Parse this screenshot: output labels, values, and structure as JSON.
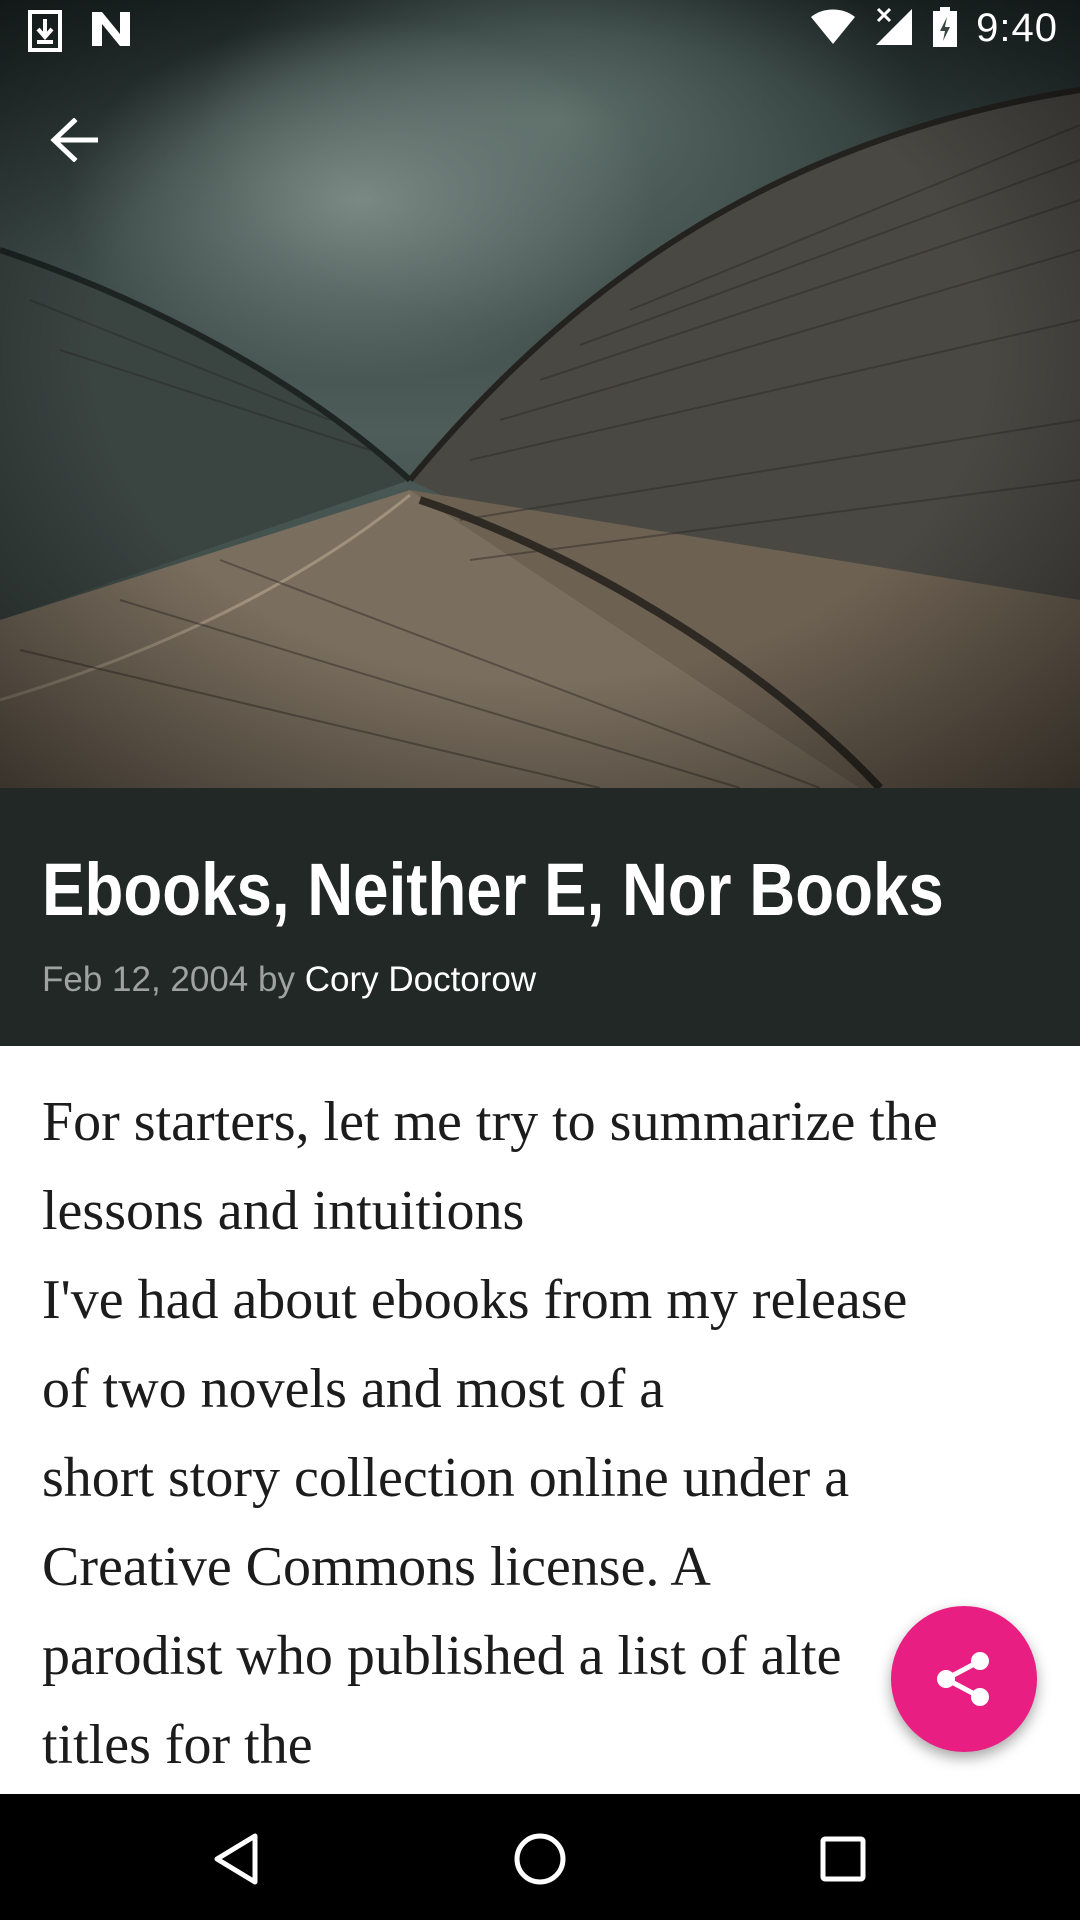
{
  "status_bar": {
    "time": "9:40",
    "icons": [
      "download-icon",
      "n-notification-icon",
      "wifi-icon",
      "cell-signal-icon",
      "battery-icon"
    ]
  },
  "hero": {
    "image_description_icon": "building-roof-photo"
  },
  "toolbar": {
    "back_icon": "arrow-back-icon"
  },
  "article": {
    "title": "Ebooks, Neither E, Nor Books",
    "date": "Feb 12, 2004",
    "by": "by",
    "author": "Cory Doctorow",
    "body_lines": [
      "For starters, let me try to summarize the",
      "lessons and intuitions",
      "I've had about ebooks from my release",
      "of two novels and most of a",
      "short story collection online under a",
      "Creative Commons license. A",
      "parodist who published a list of alte",
      "titles for the"
    ]
  },
  "fab": {
    "icon": "share-icon",
    "color": "#e91e82"
  },
  "nav_bar": {
    "back": "nav-back-icon",
    "home": "nav-home-icon",
    "recents": "nav-recents-icon"
  },
  "colors": {
    "title_band": "#222826",
    "accent": "#e91e82"
  }
}
